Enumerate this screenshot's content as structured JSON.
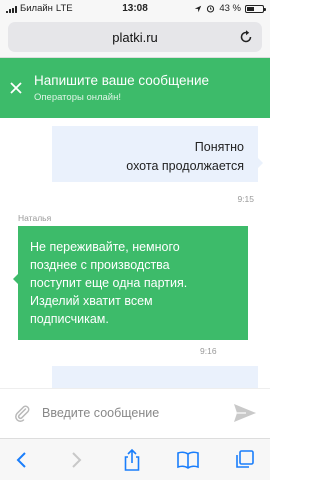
{
  "status_bar": {
    "carrier": "Билайн",
    "network": "LTE",
    "time": "13:08",
    "battery": "43 %",
    "battery_level": 0.43
  },
  "address_bar": {
    "url": "platki.ru"
  },
  "chat_header": {
    "title": "Напишите ваше сообщение",
    "subtitle": "Операторы онлайн!"
  },
  "messages": [
    {
      "direction": "outgoing",
      "lines": [
        "Понятно",
        "охота продолжается"
      ],
      "time": "9:15"
    },
    {
      "direction": "incoming",
      "sender": "Наталья",
      "lines": [
        "Не переживайте, немного",
        "позднее с производства",
        "поступит еще одна партия.",
        "Изделий хватит всем",
        "подписчикам."
      ],
      "time": "9:16"
    }
  ],
  "composer": {
    "placeholder": "Введите сообщение",
    "value": ""
  },
  "colors": {
    "accent": "#3dbb6a",
    "outgoing_bubble": "#eaf1fc",
    "ios_blue": "#1a7efb"
  },
  "icons": [
    "close-icon",
    "reload-icon",
    "attach-icon",
    "send-icon",
    "back-icon",
    "forward-icon",
    "share-icon",
    "bookmarks-icon",
    "tabs-icon",
    "alarm-icon",
    "location-icon"
  ]
}
